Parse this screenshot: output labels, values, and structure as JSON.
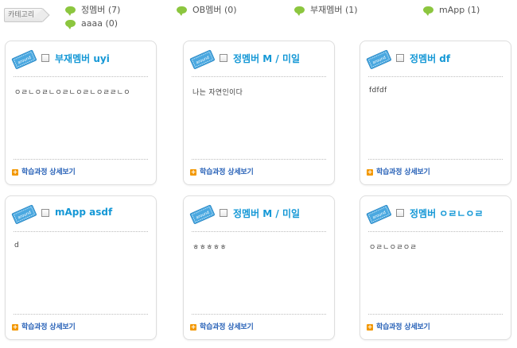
{
  "category": {
    "label": "카테고리",
    "items": [
      {
        "label": "정멤버 (7)"
      },
      {
        "label": "OB멤버 (0)"
      },
      {
        "label": "부재멤버 (1)"
      },
      {
        "label": "mApp (1)"
      },
      {
        "label": "aaaa (0)"
      }
    ]
  },
  "ticket_icon_text": "around",
  "cards": [
    {
      "name": "부재멤버 uyi",
      "intro": "ㅇㄹㄴㅇㄹㄴㅇㄹㄴㅇㄹㄴㅇㄹㄹㄴㅇ",
      "detail_label": "학습과정 상세보기"
    },
    {
      "name": "정멤버 M / 미일",
      "intro": "나는 자연인이다",
      "detail_label": "학습과정 상세보기"
    },
    {
      "name": "정멤버 df",
      "intro": "fdfdf",
      "detail_label": "학습과정 상세보기"
    },
    {
      "name": "mApp asdf",
      "intro": "d",
      "detail_label": "학습과정 상세보기"
    },
    {
      "name": "정멤버 M / 미일",
      "intro": "ㅎㅎㅎㅎㅎ",
      "detail_label": "학습과정 상세보기"
    },
    {
      "name": "정멤버 ㅇㄹㄴㅇㄹ",
      "intro": "ㅇㄹㄴㅇㄹㅇㄹ",
      "detail_label": "학습과정 상세보기"
    }
  ],
  "colors": {
    "name": "#1598d6",
    "detail_link": "#2a63b8",
    "plus_icon": "#f39800",
    "category_bubble": "#8cc63f",
    "ticket_icon": "#4aa8e0"
  }
}
